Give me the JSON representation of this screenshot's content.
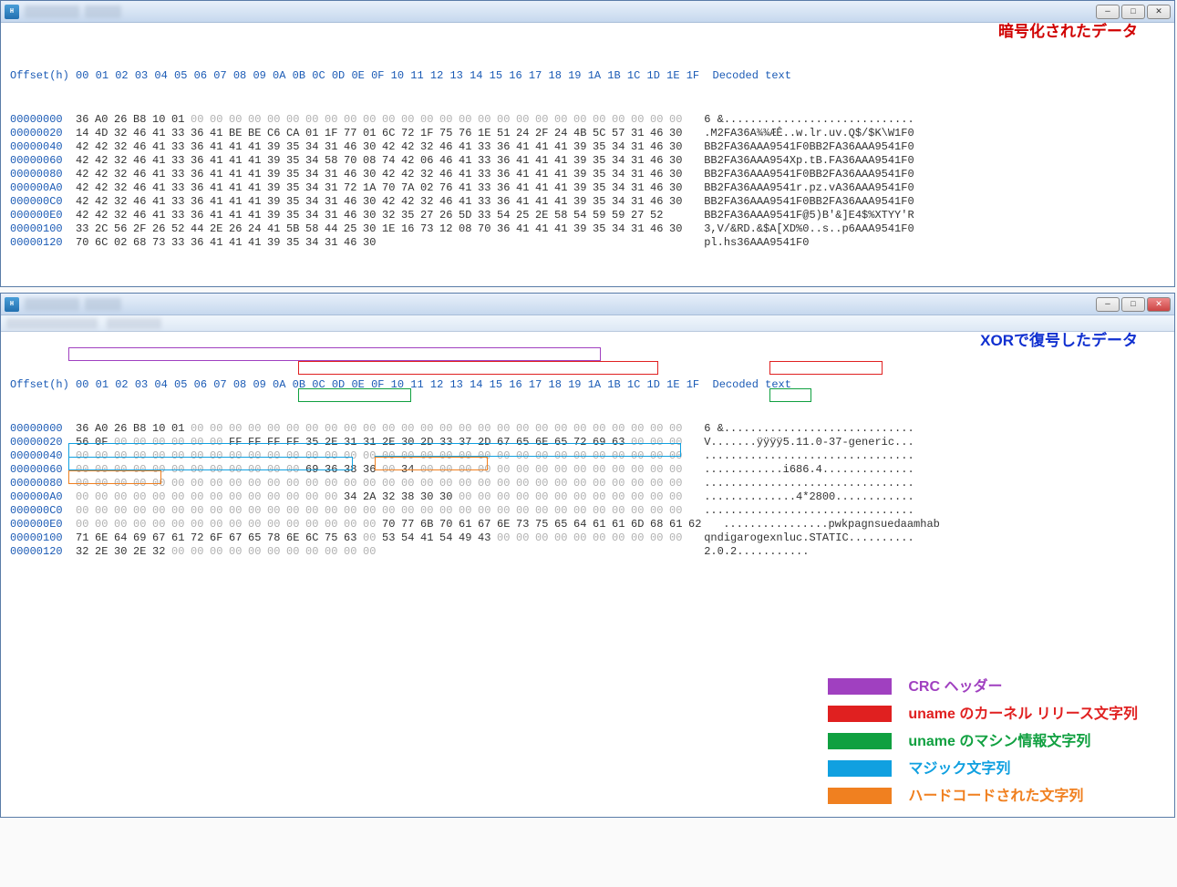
{
  "window1": {
    "annotation": "暗号化されたデータ",
    "header": "Offset(h) 00 01 02 03 04 05 06 07 08 09 0A 0B 0C 0D 0E 0F 10 11 12 13 14 15 16 17 18 19 1A 1B 1C 1D 1E 1F  Decoded text",
    "rows": [
      {
        "o": "00000000",
        "h": "36 A0 26 B8 10 01 00 00 00 00 00 00 00 00 00 00 00 00 00 00 00 00 00 00 00 00 00 00 00 00 00 00",
        "d": "6 &............................."
      },
      {
        "o": "00000020",
        "h": "14 4D 32 46 41 33 36 41 BE BE C6 CA 01 1F 77 01 6C 72 1F 75 76 1E 51 24 2F 24 4B 5C 57 31 46 30",
        "d": ".M2FA36A¾¾ÆÊ..w.lr.uv.Q$/$K\\W1F0"
      },
      {
        "o": "00000040",
        "h": "42 42 32 46 41 33 36 41 41 41 39 35 34 31 46 30 42 42 32 46 41 33 36 41 41 41 39 35 34 31 46 30",
        "d": "BB2FA36AAA9541F0BB2FA36AAA9541F0"
      },
      {
        "o": "00000060",
        "h": "42 42 32 46 41 33 36 41 41 41 39 35 34 58 70 08 74 42 06 46 41 33 36 41 41 41 39 35 34 31 46 30",
        "d": "BB2FA36AAA954Xp.tB.FA36AAA9541F0"
      },
      {
        "o": "00000080",
        "h": "42 42 32 46 41 33 36 41 41 41 39 35 34 31 46 30 42 42 32 46 41 33 36 41 41 41 39 35 34 31 46 30",
        "d": "BB2FA36AAA9541F0BB2FA36AAA9541F0"
      },
      {
        "o": "000000A0",
        "h": "42 42 32 46 41 33 36 41 41 41 39 35 34 31 72 1A 70 7A 02 76 41 33 36 41 41 41 39 35 34 31 46 30",
        "d": "BB2FA36AAA9541r.pz.vA36AAA9541F0"
      },
      {
        "o": "000000C0",
        "h": "42 42 32 46 41 33 36 41 41 41 39 35 34 31 46 30 42 42 32 46 41 33 36 41 41 41 39 35 34 31 46 30",
        "d": "BB2FA36AAA9541F0BB2FA36AAA9541F0"
      },
      {
        "o": "000000E0",
        "h": "42 42 32 46 41 33 36 41 41 41 39 35 34 31 46 30 32 35 27 26 5D 33 54 25 2E 58 54 59 59 27 52",
        "d": "BB2FA36AAA9541F@5)B'&]E4$%XTYY'R"
      },
      {
        "o": "00000100",
        "h": "33 2C 56 2F 26 52 44 2E 26 24 41 5B 58 44 25 30 1E 16 73 12 08 70 36 41 41 41 39 35 34 31 46 30",
        "d": "3,V/&RD.&$A[XD%0..s..p6AAA9541F0"
      },
      {
        "o": "00000120",
        "h": "70 6C 02 68 73 33 36 41 41 41 39 35 34 31 46 30",
        "d": "pl.hs36AAA9541F0"
      }
    ]
  },
  "window2": {
    "annotation": "XORで復号したデータ",
    "header": "Offset(h) 00 01 02 03 04 05 06 07 08 09 0A 0B 0C 0D 0E 0F 10 11 12 13 14 15 16 17 18 19 1A 1B 1C 1D 1E 1F  Decoded text",
    "rows": [
      {
        "o": "00000000",
        "h": "36 A0 26 B8 10 01 00 00 00 00 00 00 00 00 00 00 00 00 00 00 00 00 00 00 00 00 00 00 00 00 00 00",
        "d": "6 &............................."
      },
      {
        "o": "00000020",
        "h": "56 0F 00 00 00 00 00 00 FF FF FF FF 35 2E 31 31 2E 30 2D 33 37 2D 67 65 6E 65 72 69 63 00 00 00",
        "d": "V.......ÿÿÿÿ5.11.0-37-generic..."
      },
      {
        "o": "00000040",
        "h": "00 00 00 00 00 00 00 00 00 00 00 00 00 00 00 00 00 00 00 00 00 00 00 00 00 00 00 00 00 00 00 00",
        "d": "................................"
      },
      {
        "o": "00000060",
        "h": "00 00 00 00 00 00 00 00 00 00 00 00 69 36 38 36 00 34 00 00 00 00 00 00 00 00 00 00 00 00 00 00",
        "d": "............i686.4.............."
      },
      {
        "o": "00000080",
        "h": "00 00 00 00 00 00 00 00 00 00 00 00 00 00 00 00 00 00 00 00 00 00 00 00 00 00 00 00 00 00 00 00",
        "d": "................................"
      },
      {
        "o": "000000A0",
        "h": "00 00 00 00 00 00 00 00 00 00 00 00 00 00 34 2A 32 38 30 30 00 00 00 00 00 00 00 00 00 00 00 00",
        "d": "..............4*2800............"
      },
      {
        "o": "000000C0",
        "h": "00 00 00 00 00 00 00 00 00 00 00 00 00 00 00 00 00 00 00 00 00 00 00 00 00 00 00 00 00 00 00 00",
        "d": "................................"
      },
      {
        "o": "000000E0",
        "h": "00 00 00 00 00 00 00 00 00 00 00 00 00 00 00 00 70 77 6B 70 61 67 6E 73 75 65 64 61 61 6D 68 61 62",
        "d": "................pwkpagnsuedaamhab"
      },
      {
        "o": "00000100",
        "h": "71 6E 64 69 67 61 72 6F 67 65 78 6E 6C 75 63 00 53 54 41 54 49 43 00 00 00 00 00 00 00 00 00 00",
        "d": "qndigarogexnluc.STATIC.........."
      },
      {
        "o": "00000120",
        "h": "32 2E 30 2E 32 00 00 00 00 00 00 00 00 00 00 00",
        "d": "2.0.2..........."
      }
    ],
    "legend": [
      {
        "color": "purple",
        "label": "CRC ヘッダー"
      },
      {
        "color": "red",
        "label": "uname のカーネル リリース文字列"
      },
      {
        "color": "green",
        "label": "uname のマシン情報文字列"
      },
      {
        "color": "cyan",
        "label": "マジック文字列"
      },
      {
        "color": "orange",
        "label": "ハードコードされた文字列"
      }
    ],
    "highlight_text": {
      "kernel": "5.11.0-37-generic",
      "machine": "i686.4"
    }
  }
}
